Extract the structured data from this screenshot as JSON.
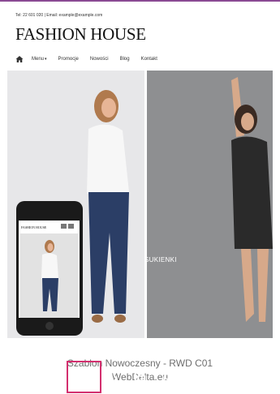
{
  "header": {
    "contact_text": "Tel: 22 601 020 | Email: example@example.com",
    "brand": "FASHION HOUSE"
  },
  "nav": {
    "items": [
      {
        "label": "Menu"
      },
      {
        "label": "Promocje"
      },
      {
        "label": "Nowości"
      },
      {
        "label": "Blog"
      },
      {
        "label": "Kontakt"
      }
    ]
  },
  "hero": {
    "right_label": "SUKIENKI",
    "phone_brand": "FASHION HOUSE"
  },
  "caption": {
    "line1": "Szablon Nowoczesny - RWD C01",
    "line2": "WebDelta.eu"
  },
  "toolbar": {
    "icons": [
      "search-icon",
      "pencil-icon",
      "code-icon",
      "copy-icon",
      "check-circle-icon",
      "close-icon",
      "gear-icon"
    ],
    "active_tool": "pencil-icon",
    "accent_color": "#d32f6e"
  },
  "colors": {
    "top_line": "#8a4a93",
    "caption": "#6e6e6e"
  }
}
